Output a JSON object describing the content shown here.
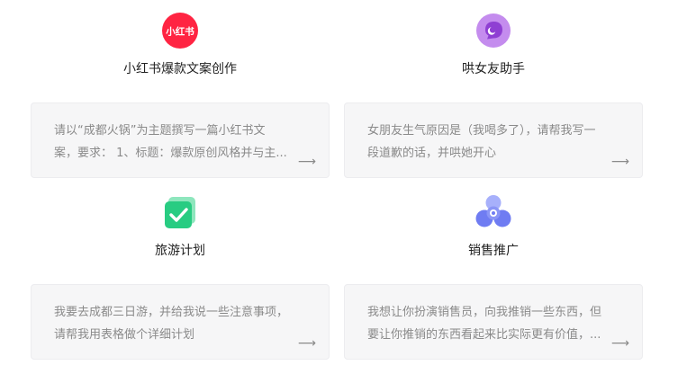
{
  "cards": [
    {
      "title": "小红书爆款文案创作",
      "icon": "xiaohongshu-icon",
      "icon_text": "小红书",
      "prompt_line1": "请以“成都火锅”为主题撰写一篇小红书文",
      "prompt_line2": "案，要求： 1、标题：爆款原创风格并与主...",
      "arrow": "⟶"
    },
    {
      "title": "哄女友助手",
      "icon": "chat-bubble-icon",
      "prompt_line1": "女朋友生气原因是（我喝多了），请帮我写一",
      "prompt_line2": "段道歉的话，并哄她开心",
      "arrow": "⟶"
    },
    {
      "title": "旅游计划",
      "icon": "checkbox-icon",
      "prompt_line1": "我要去成都三日游，并给我说一些注意事项，",
      "prompt_line2": "请帮我用表格做个详细计划",
      "arrow": "⟶"
    },
    {
      "title": "销售推广",
      "icon": "sales-nodes-icon",
      "prompt_line1": "我想让你扮演销售员，向我推销一些东西，但",
      "prompt_line2": "要让你推销的东西看起来比实际更有价值，...",
      "arrow": "⟶"
    }
  ],
  "colors": {
    "xiaohongshu_red": "#ff2442",
    "chat_purple": "#b97be8",
    "check_green": "#2fd08a",
    "sales_blue": "#6f7cf2",
    "card_bg": "#f6f6f7"
  }
}
